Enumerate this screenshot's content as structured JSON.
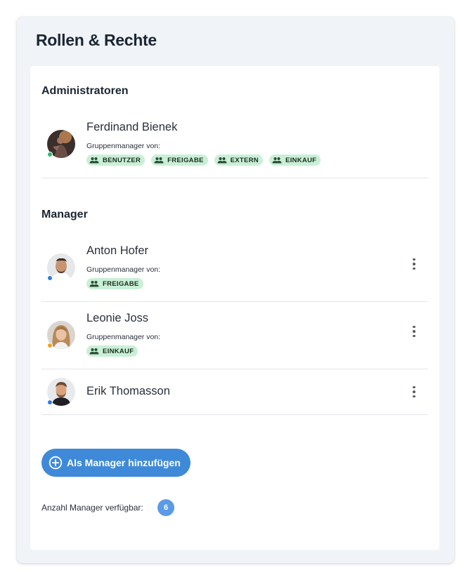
{
  "page": {
    "title": "Rollen & Rechte"
  },
  "administrators": {
    "section_title": "Administratoren",
    "people": [
      {
        "name": "Ferdinand Bienek",
        "status_color": "#2eb872",
        "group_label": "Gruppenmanager von:",
        "groups": [
          "BENUTZER",
          "FREIGABE",
          "EXTERN",
          "EINKAUF"
        ]
      }
    ]
  },
  "managers": {
    "section_title": "Manager",
    "people": [
      {
        "name": "Anton Hofer",
        "status_color": "#2d7be5",
        "group_label": "Gruppenmanager von:",
        "groups": [
          "FREIGABE"
        ]
      },
      {
        "name": "Leonie Joss",
        "status_color": "#f0a31f",
        "group_label": "Gruppenmanager von:",
        "groups": [
          "EINKAUF"
        ]
      },
      {
        "name": "Erik Thomasson",
        "status_color": "#2d7be5"
      }
    ]
  },
  "actions": {
    "add_manager_label": "Als Manager hinzufügen",
    "add_manager_icon": "plus-circle-icon"
  },
  "availability": {
    "label": "Anzahl Manager verfügbar:",
    "count": "6"
  },
  "colors": {
    "chip_bg": "#c9f0d6",
    "primary": "#3f8ad8",
    "badge": "#5b9ae6"
  }
}
